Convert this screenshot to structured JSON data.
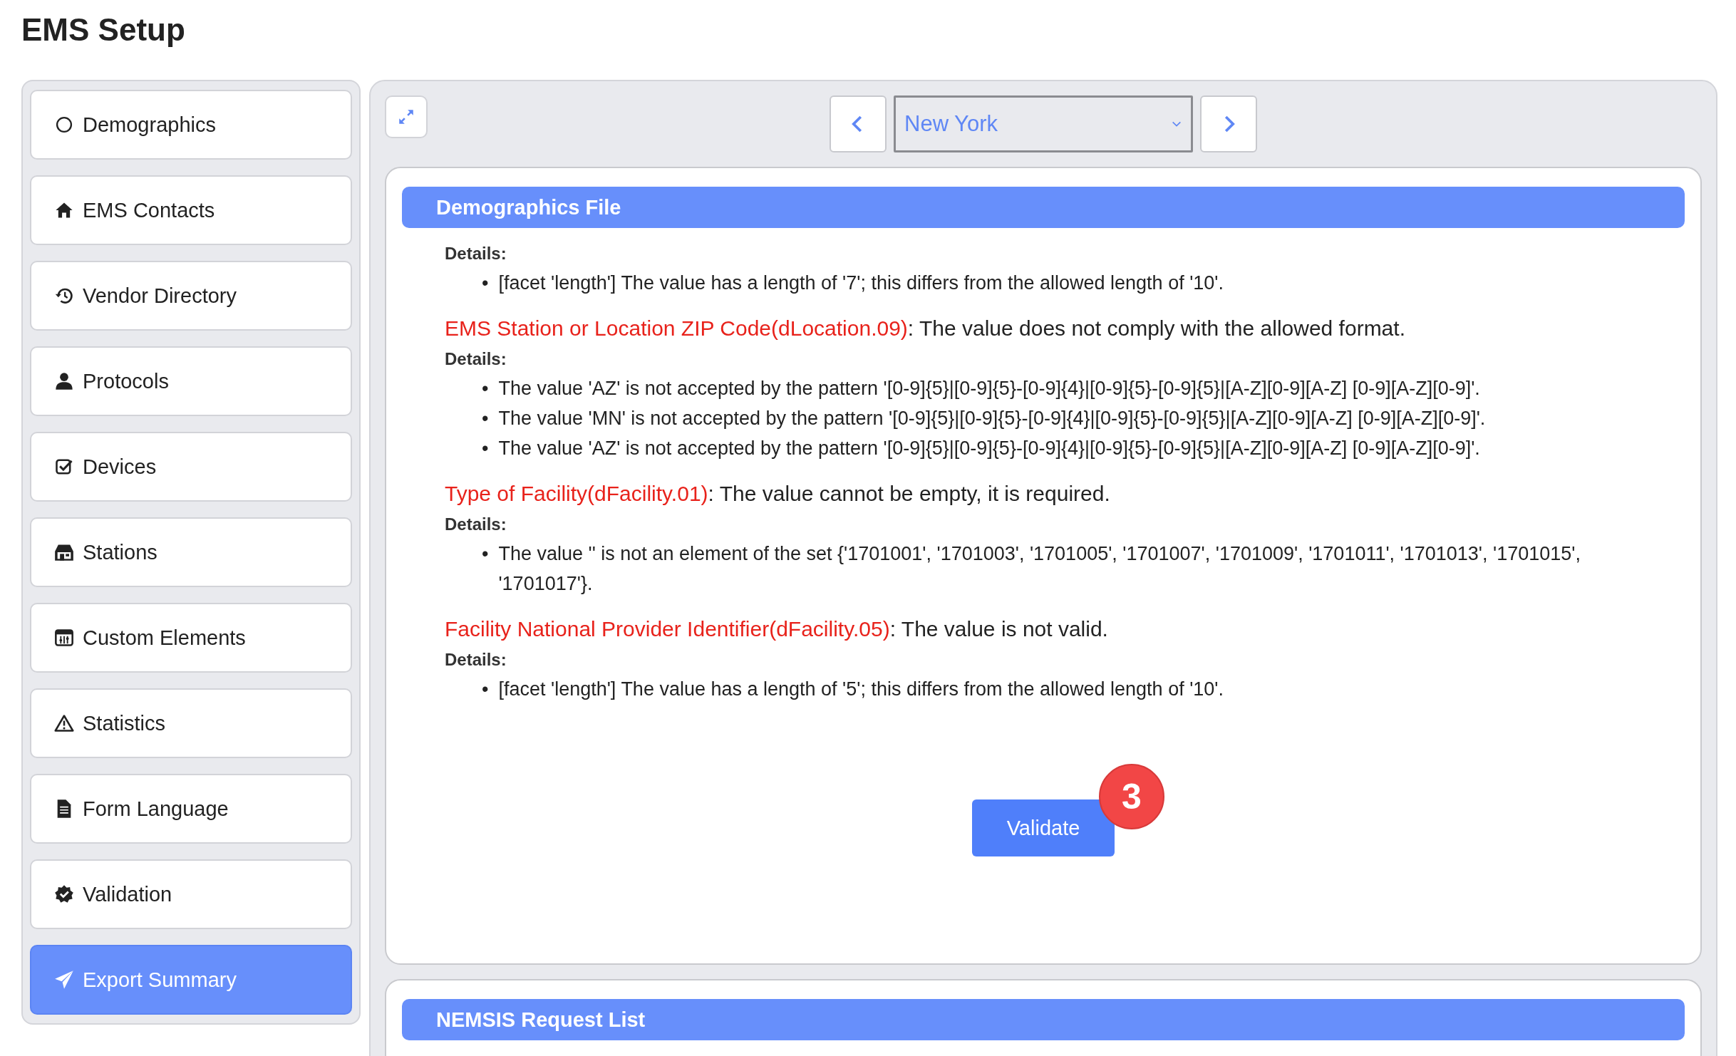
{
  "page_title": "EMS Setup",
  "sidebar": {
    "items": [
      {
        "label": "Demographics",
        "selected": false
      },
      {
        "label": "EMS Contacts",
        "selected": false
      },
      {
        "label": "Vendor Directory",
        "selected": false
      },
      {
        "label": "Protocols",
        "selected": false
      },
      {
        "label": "Devices",
        "selected": false
      },
      {
        "label": "Stations",
        "selected": false
      },
      {
        "label": "Custom Elements",
        "selected": false
      },
      {
        "label": "Statistics",
        "selected": false
      },
      {
        "label": "Form Language",
        "selected": false
      },
      {
        "label": "Validation",
        "selected": false
      },
      {
        "label": "Export Summary",
        "selected": true
      }
    ]
  },
  "toolbar": {
    "location": "New York"
  },
  "sections": [
    {
      "title": "Demographics File",
      "errors": [
        {
          "details_label": "Details:",
          "details": [
            {
              "bullet": "•",
              "text": "[facet 'length'] The value has a length of '7'; this differs from the allowed length of '10'."
            }
          ]
        },
        {
          "field": "EMS Station or Location ZIP Code(dLocation.09)",
          "message": ": The value does not comply with the allowed format.",
          "details_label": "Details:",
          "details": [
            {
              "bullet": "•",
              "text": "The value 'AZ' is not accepted by the pattern '[0-9]{5}|[0-9]{5}-[0-9]{4}|[0-9]{5}-[0-9]{5}|[A-Z][0-9][A-Z] [0-9][A-Z][0-9]'."
            },
            {
              "bullet": "•",
              "text": "The value 'MN' is not accepted by the pattern '[0-9]{5}|[0-9]{5}-[0-9]{4}|[0-9]{5}-[0-9]{5}|[A-Z][0-9][A-Z] [0-9][A-Z][0-9]'."
            },
            {
              "bullet": "•",
              "text": "The value 'AZ' is not accepted by the pattern '[0-9]{5}|[0-9]{5}-[0-9]{4}|[0-9]{5}-[0-9]{5}|[A-Z][0-9][A-Z] [0-9][A-Z][0-9]'."
            }
          ]
        },
        {
          "field": "Type of Facility(dFacility.01)",
          "message": ": The value cannot be empty, it is required.",
          "details_label": "Details:",
          "details": [
            {
              "bullet": "•",
              "text": "The value '' is not an element of the set {'1701001', '1701003', '1701005', '1701007', '1701009', '1701011', '1701013', '1701015', '1701017'}."
            }
          ]
        },
        {
          "field": "Facility National Provider Identifier(dFacility.05)",
          "message": ": The value is not valid.",
          "details_label": "Details:",
          "details": [
            {
              "bullet": "•",
              "text": "[facet 'length'] The value has a length of '5'; this differs from the allowed length of '10'."
            }
          ]
        }
      ],
      "button": "Validate",
      "badge": "3"
    },
    {
      "title": "NEMSIS Request List"
    }
  ]
}
